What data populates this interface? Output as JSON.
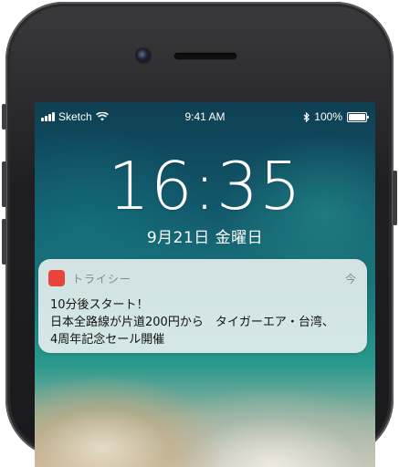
{
  "status_bar": {
    "carrier": "Sketch",
    "time": "9:41 AM",
    "battery_percent": "100%",
    "battery_level": 1.0
  },
  "lock_screen": {
    "clock": "16:35",
    "date": "9月21日 金曜日"
  },
  "notification": {
    "app_name": "トライシー",
    "time": "今",
    "lines": [
      "10分後スタート！",
      "日本全路線が片道200円から　タイガーエア・台湾、",
      "4周年記念セール開催"
    ],
    "app_icon_color": "#e8443a"
  },
  "icons": [
    "signal-icon",
    "wifi-icon",
    "bluetooth-icon",
    "battery-icon",
    "app-icon"
  ]
}
